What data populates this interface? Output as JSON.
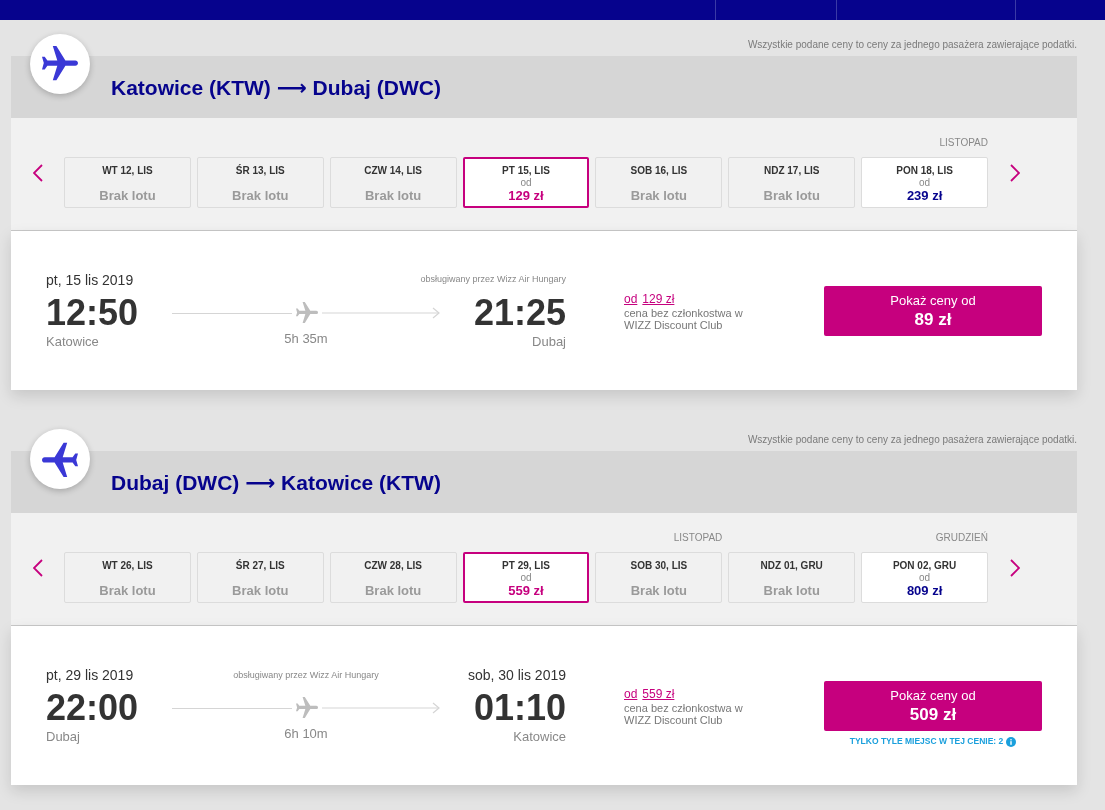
{
  "sections": [
    {
      "kind": "outbound",
      "price_note": "Wszystkie podane ceny to ceny za jednego pasażera zawierające podatki.",
      "route": "Katowice (KTW) ⟶ Dubaj (DWC)",
      "days": [
        {
          "label": "WT 12, LIS",
          "kind": "no_flight",
          "status": "Brak lotu",
          "selected": false
        },
        {
          "label": "ŚR 13, LIS",
          "kind": "no_flight",
          "status": "Brak lotu",
          "selected": false
        },
        {
          "label": "CZW 14, LIS",
          "kind": "no_flight",
          "status": "Brak lotu",
          "selected": false
        },
        {
          "label": "PT 15, LIS",
          "kind": "price",
          "from": "od",
          "price": "129 zł",
          "selected": true
        },
        {
          "label": "SOB 16, LIS",
          "kind": "no_flight",
          "status": "Brak lotu",
          "selected": false
        },
        {
          "label": "NDZ 17, LIS",
          "kind": "no_flight",
          "status": "Brak lotu",
          "selected": false
        },
        {
          "label": "PON 18, LIS",
          "month": "LISTOPAD",
          "kind": "price",
          "from": "od",
          "price": "239 zł",
          "selected": false
        }
      ],
      "flight": {
        "departure": {
          "date": "pt, 15 lis 2019",
          "time": "12:50",
          "city": "Katowice"
        },
        "operator": "obsługiwany przez Wizz Air Hungary",
        "duration": "5h 35m",
        "arrival": {
          "time": "21:25",
          "city": "Dubaj"
        },
        "price_info": {
          "from_link": "od",
          "price_link": "129 zł",
          "note": "cena bez członkostwa w WIZZ Discount Club"
        },
        "button": {
          "label": "Pokaż ceny od",
          "price": "89 zł"
        }
      }
    },
    {
      "kind": "return",
      "price_note": "Wszystkie podane ceny to ceny za jednego pasażera zawierające podatki.",
      "route": "Dubaj (DWC) ⟶ Katowice (KTW)",
      "days": [
        {
          "label": "WT 26, LIS",
          "kind": "no_flight",
          "status": "Brak lotu",
          "selected": false
        },
        {
          "label": "ŚR 27, LIS",
          "kind": "no_flight",
          "status": "Brak lotu",
          "selected": false
        },
        {
          "label": "CZW 28, LIS",
          "kind": "no_flight",
          "status": "Brak lotu",
          "selected": false
        },
        {
          "label": "PT 29, LIS",
          "kind": "price",
          "from": "od",
          "price": "559 zł",
          "selected": true
        },
        {
          "label": "SOB 30, LIS",
          "month": "LISTOPAD",
          "kind": "no_flight",
          "status": "Brak lotu",
          "selected": false
        },
        {
          "label": "NDZ 01, GRU",
          "kind": "no_flight",
          "status": "Brak lotu",
          "selected": false
        },
        {
          "label": "PON 02, GRU",
          "month": "GRUDZIEŃ",
          "kind": "price",
          "from": "od",
          "price": "809 zł",
          "selected": false
        }
      ],
      "flight": {
        "departure": {
          "date": "pt, 29 lis 2019",
          "time": "22:00",
          "city": "Dubaj"
        },
        "operator": "obsługiwany przez Wizz Air Hungary",
        "duration": "6h 10m",
        "arrival": {
          "date": "sob, 30 lis 2019",
          "time": "01:10",
          "city": "Katowice"
        },
        "price_info": {
          "from_link": "od",
          "price_link": "559 zł",
          "note": "cena bez członkostwa w WIZZ Discount Club"
        },
        "button": {
          "label": "Pokaż ceny od",
          "price": "509 zł"
        },
        "seats_note": "TYLKO TYLE MIEJSC W TEJ CENIE: 2"
      }
    }
  ]
}
